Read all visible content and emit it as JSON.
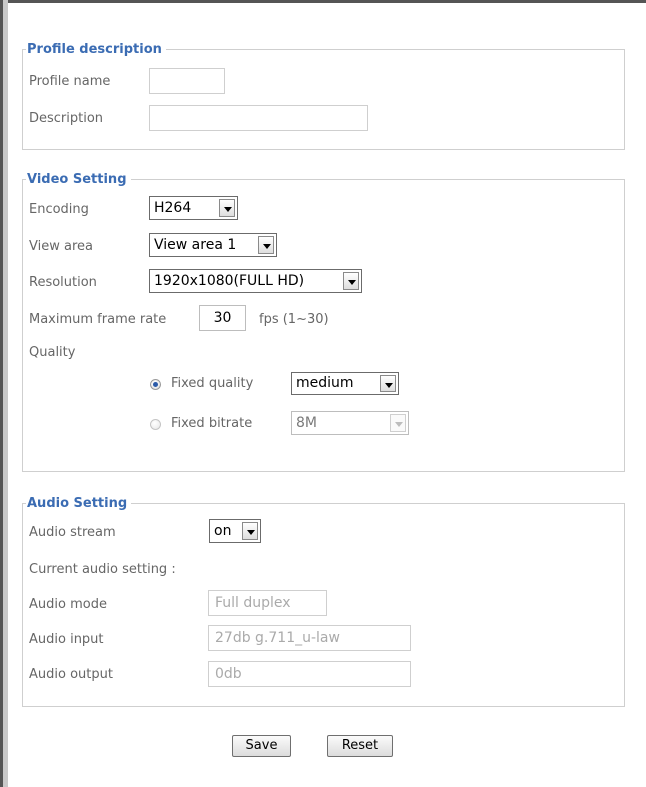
{
  "profile": {
    "legend": "Profile description",
    "name_label": "Profile name",
    "name_value": "",
    "description_label": "Description",
    "description_value": ""
  },
  "video": {
    "legend": "Video Setting",
    "encoding_label": "Encoding",
    "encoding_value": "H264",
    "view_area_label": "View area",
    "view_area_value": "View area 1",
    "resolution_label": "Resolution",
    "resolution_value": "1920x1080(FULL HD)",
    "frame_rate_label": "Maximum frame rate",
    "frame_rate_value": "30",
    "frame_rate_unit": "fps (1~30)",
    "quality_label": "Quality",
    "fixed_quality_label": "Fixed quality",
    "fixed_quality_value": "medium",
    "fixed_bitrate_label": "Fixed bitrate",
    "fixed_bitrate_value": "8M"
  },
  "audio": {
    "legend": "Audio Setting",
    "stream_label": "Audio stream",
    "stream_value": "on",
    "current_label": "Current audio setting :",
    "mode_label": "Audio mode",
    "mode_value": "Full duplex",
    "input_label": "Audio input",
    "input_value": "27db g.711_u-law",
    "output_label": "Audio output",
    "output_value": "0db"
  },
  "buttons": {
    "save_label": "Save",
    "reset_label": "Reset"
  },
  "colors": {
    "legend_text": "#3b6cb3",
    "label_text": "#666666",
    "border": "#cfcfcf",
    "radio_selected": "#2b5aa8"
  }
}
